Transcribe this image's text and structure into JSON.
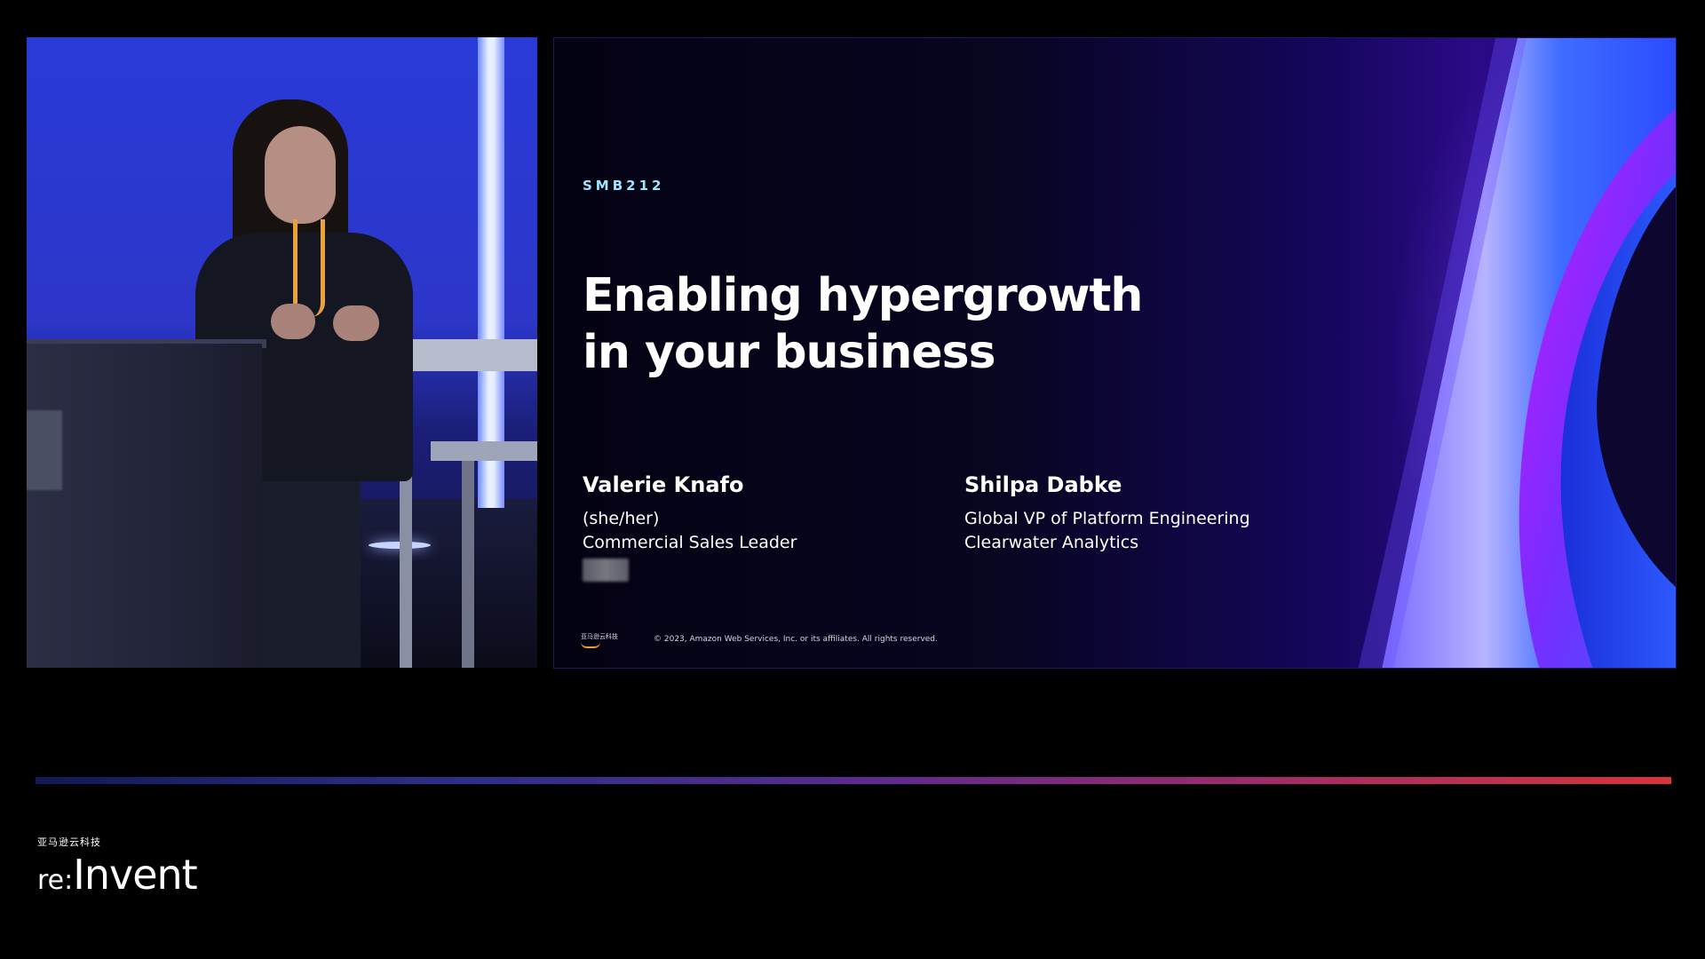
{
  "camera": {
    "subject": "speaker-on-stage"
  },
  "slide": {
    "session_code": "SMB212",
    "title_lines": [
      "Enabling hypergrowth",
      "in your business"
    ],
    "speakers": [
      {
        "name": "Valerie Knafo",
        "lines": [
          "(she/her)",
          "Commercial Sales Leader"
        ]
      },
      {
        "name": "Shilpa Dabke",
        "lines": [
          "Global VP of Platform Engineering",
          "Clearwater Analytics"
        ]
      }
    ],
    "footer_logo_text": "亚马逊云科技",
    "copyright": "© 2023, Amazon Web Services, Inc. or its affiliates. All rights reserved."
  },
  "brand": {
    "cn_label": "亚马逊云科技",
    "re": "re:",
    "invent": "Invent"
  },
  "colors": {
    "background": "#000000",
    "session_code": "#9ee6ff",
    "title": "#ffffff",
    "accent_bar_start": "#101a55",
    "accent_bar_end": "#d8343a",
    "swoosh_blue": "#3f6dff",
    "swoosh_magenta": "#b31dff"
  },
  "icons": {
    "aws_smile": "aws-smile-icon"
  }
}
